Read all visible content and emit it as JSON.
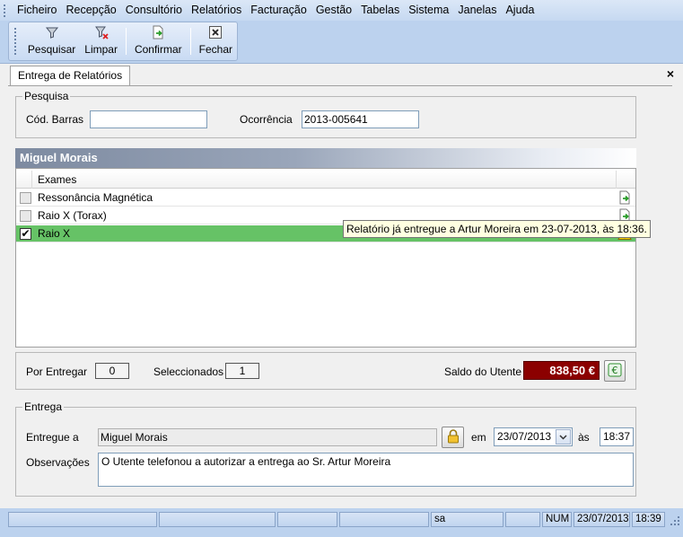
{
  "menu": [
    "Ficheiro",
    "Recepção",
    "Consultório",
    "Relatórios",
    "Facturação",
    "Gestão",
    "Tabelas",
    "Sistema",
    "Janelas",
    "Ajuda"
  ],
  "toolbar": {
    "search": "Pesquisar",
    "clear": "Limpar",
    "confirm": "Confirmar",
    "close": "Fechar"
  },
  "tab": {
    "label": "Entrega de Relatórios",
    "close": "×"
  },
  "search_group": {
    "title": "Pesquisa",
    "barcode_label": "Cód. Barras",
    "barcode_value": "",
    "occurrence_label": "Ocorrência",
    "occurrence_value": "2013-005641"
  },
  "patient_name": "Miguel Morais",
  "exams": {
    "header": "Exames",
    "rows": [
      {
        "name": "Ressonância Magnética",
        "checked": false,
        "selected": false
      },
      {
        "name": "Raio X (Torax)",
        "checked": false,
        "selected": false
      },
      {
        "name": "Raio X",
        "checked": true,
        "selected": true
      }
    ],
    "tooltip": "Relatório já entregue a Artur Moreira em 23-07-2013, às 18:36."
  },
  "summary": {
    "pending_label": "Por Entregar",
    "pending_value": "0",
    "selected_label": "Seleccionados",
    "selected_value": "1",
    "balance_label": "Saldo do Utente",
    "balance_value": "838,50 €"
  },
  "delivery": {
    "title": "Entrega",
    "delivered_to_label": "Entregue a",
    "delivered_to_value": "Miguel Morais",
    "on_label": "em",
    "date_value": "23/07/2013",
    "at_label": "às",
    "time_value": "18:37",
    "notes_label": "Observações",
    "notes_value": "O Utente telefonou a autorizar a entrega ao Sr. Artur Moreira"
  },
  "status": {
    "user": "sa",
    "num": "NUM",
    "date": "23/07/2013",
    "time": "18:39"
  },
  "colors": {
    "selected_row": "#66c266",
    "balance_bg": "#8b0000",
    "app_bg": "#bcd2ee"
  }
}
